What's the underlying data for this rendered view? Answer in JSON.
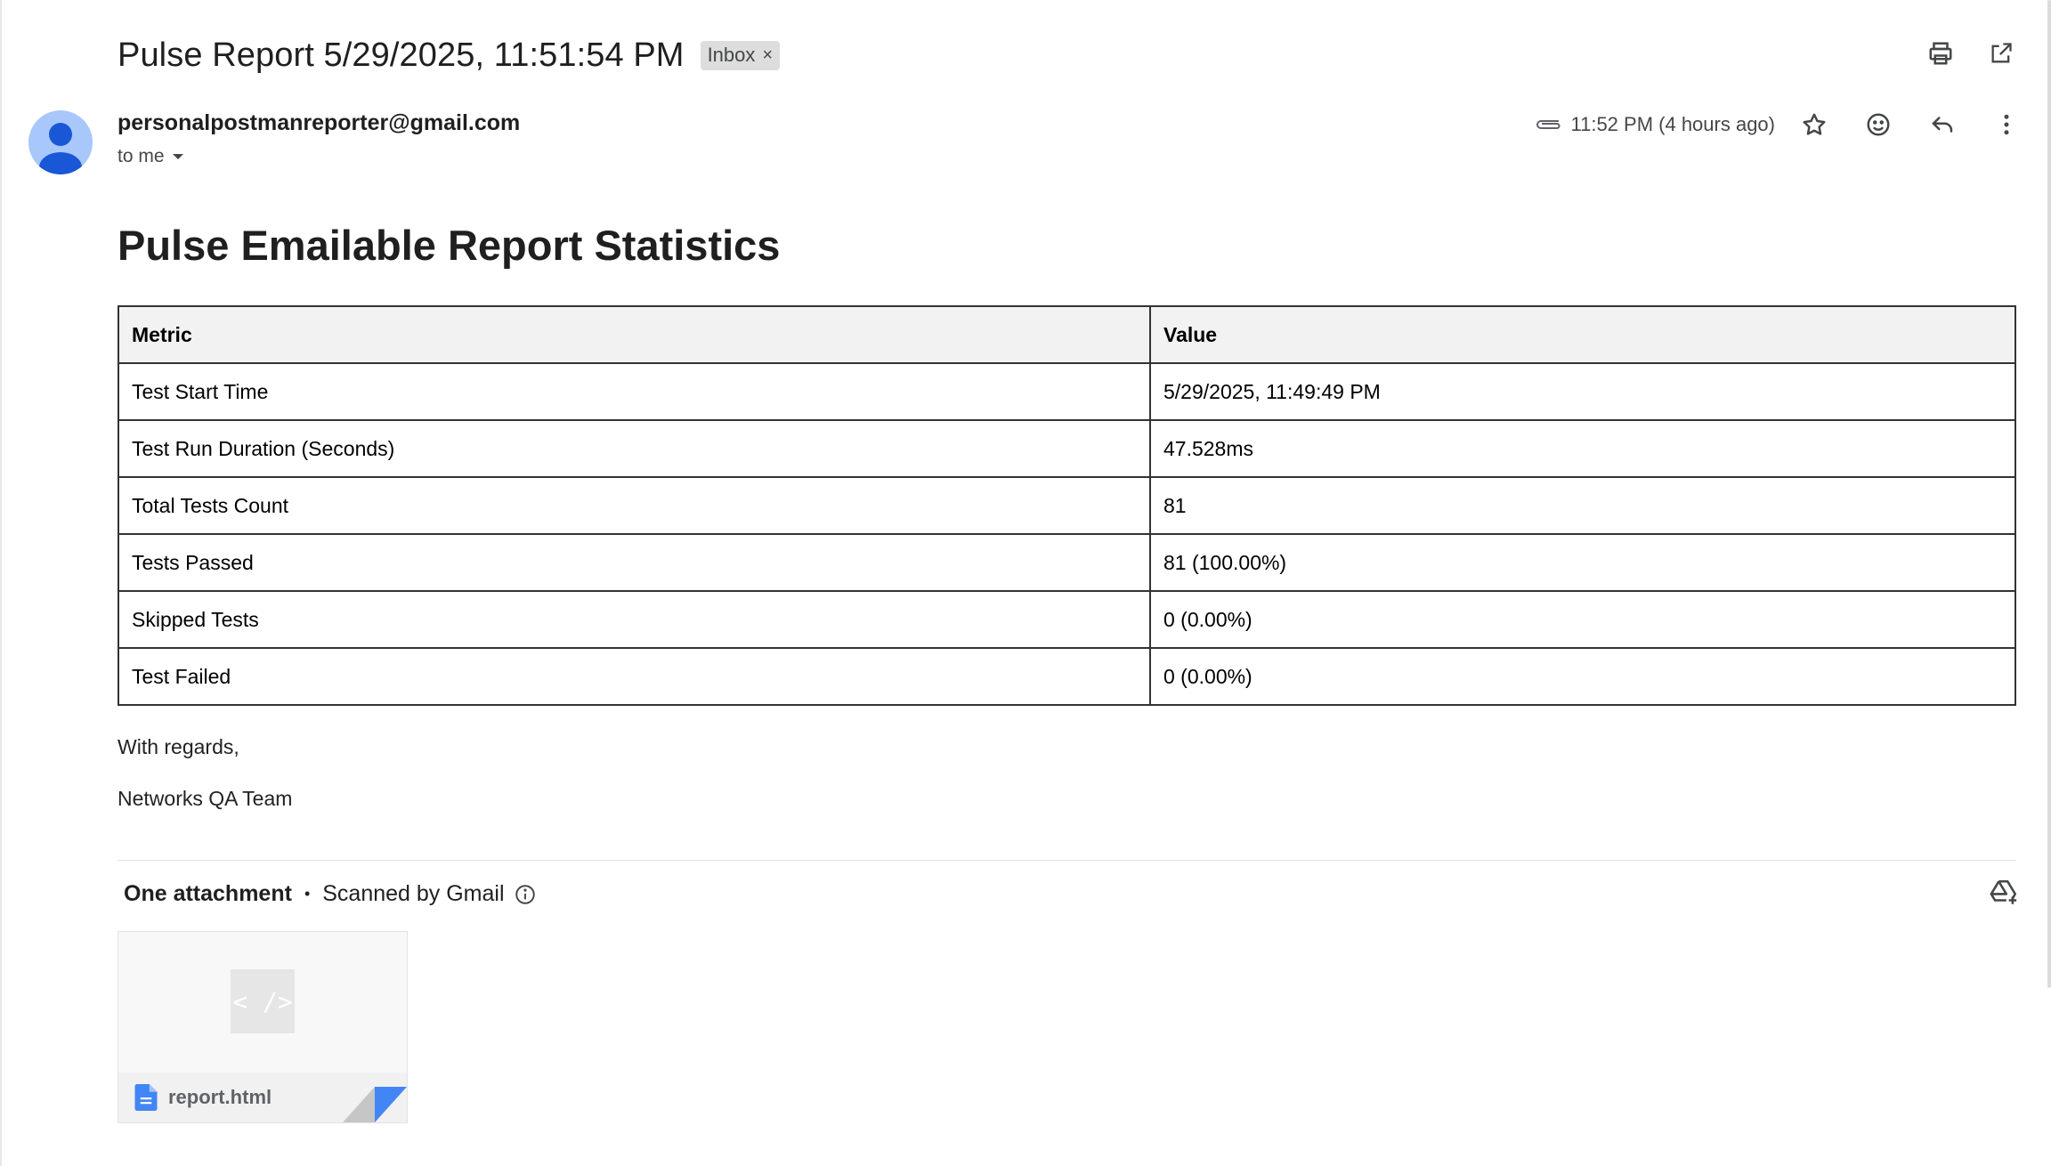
{
  "email": {
    "subject": "Pulse Report 5/29/2025, 11:51:54 PM",
    "label": "Inbox",
    "sender": "personalpostmanreporter@gmail.com",
    "recipient": "to me",
    "time": "11:52 PM (4 hours ago)"
  },
  "report": {
    "heading": "Pulse Emailable Report Statistics",
    "columns": [
      "Metric",
      "Value"
    ],
    "rows": [
      [
        "Test Start Time",
        "5/29/2025, 11:49:49 PM"
      ],
      [
        "Test Run Duration (Seconds)",
        "47.528ms"
      ],
      [
        "Total Tests Count",
        "81"
      ],
      [
        "Tests Passed",
        "81 (100.00%)"
      ],
      [
        "Skipped Tests",
        "0 (0.00%)"
      ],
      [
        "Test Failed",
        "0 (0.00%)"
      ]
    ],
    "closing": [
      "With regards,",
      "Networks QA Team"
    ]
  },
  "attachments": {
    "count_label": "One attachment",
    "scanned_label": "Scanned by Gmail",
    "files": [
      {
        "name": "report.html",
        "thumb_glyph": "< />",
        "icon": "doc-file-icon"
      }
    ]
  },
  "colors": {
    "accent_blue": "#4285f4",
    "avatar_bg": "#a8c7fa",
    "table_header_bg": "#f2f2f2",
    "chip_bg": "#dddddd"
  }
}
